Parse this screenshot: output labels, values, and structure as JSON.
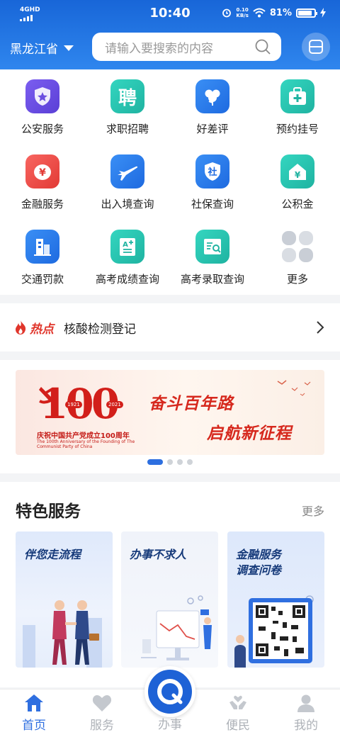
{
  "status_bar": {
    "network": "4GHD",
    "time": "10:40",
    "speed_value": "0.10",
    "speed_unit": "KB/s",
    "battery": "81%"
  },
  "header": {
    "region": "黑龙江省",
    "search_placeholder": "请输入要搜索的内容"
  },
  "services": [
    {
      "label": "公安服务",
      "icon": "police-shield-icon",
      "color": "#6b4fe0"
    },
    {
      "label": "求职招聘",
      "icon": "recruit-icon",
      "color": "#27c4b0"
    },
    {
      "label": "好差评",
      "icon": "heart-flower-icon",
      "color": "#2d7ff2"
    },
    {
      "label": "预约挂号",
      "icon": "medical-kit-icon",
      "color": "#2bc6b2"
    },
    {
      "label": "金融服务",
      "icon": "yuan-coin-icon",
      "color": "#f04a45"
    },
    {
      "label": "出入境查询",
      "icon": "airplane-icon",
      "color": "#2d7ff2"
    },
    {
      "label": "社保查询",
      "icon": "social-security-icon",
      "color": "#2d7ff2"
    },
    {
      "label": "公积金",
      "icon": "housing-fund-icon",
      "color": "#2bc6b2"
    },
    {
      "label": "交通罚款",
      "icon": "traffic-building-icon",
      "color": "#2d7ff2"
    },
    {
      "label": "高考成绩查询",
      "icon": "exam-score-icon",
      "color": "#2bc6b2"
    },
    {
      "label": "高考录取查询",
      "icon": "admission-search-icon",
      "color": "#2bc6b2"
    },
    {
      "label": "更多",
      "icon": "more-grid-icon",
      "color": "#c7ccd4"
    }
  ],
  "hot": {
    "tag": "热点",
    "text": "核酸检测登记"
  },
  "banner": {
    "number": "100",
    "year_left": "1921",
    "year_right": "2021",
    "caption_cn": "庆祝中国共产党成立100周年",
    "caption_en": "The 100th Anniversary of the Founding of The Communist Party of China",
    "slogan1": "奋斗百年路",
    "slogan2": "启航新征程",
    "page_index": 0,
    "page_count": 4
  },
  "featured": {
    "title": "特色服务",
    "more": "更多",
    "cards": [
      {
        "title": "伴您走流程"
      },
      {
        "title": "办事不求人"
      },
      {
        "title_line1": "金融服务",
        "title_line2": "调查问卷"
      }
    ]
  },
  "tabs": {
    "home": "首页",
    "service": "服务",
    "center": "办事",
    "people": "便民",
    "mine": "我的"
  },
  "colors": {
    "primary": "#1e62d6",
    "header_top": "#1866d8",
    "hot_red": "#e0352b",
    "banner_red": "#d21f1a",
    "tab_inactive": "#aeb2b8"
  }
}
